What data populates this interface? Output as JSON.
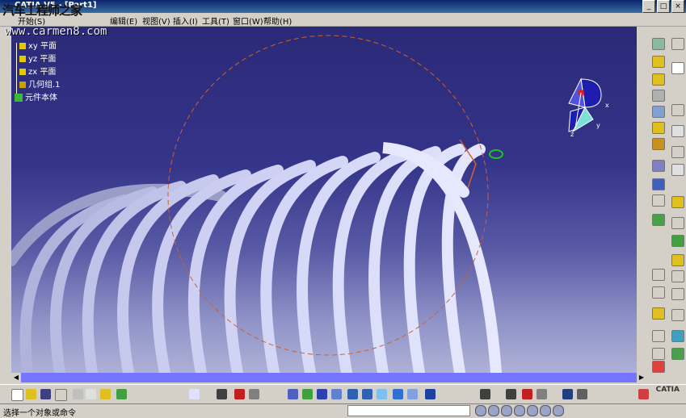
{
  "window": {
    "title": "CATIA V5 - [Part1]"
  },
  "watermark": {
    "line1": "汽车工程师之家",
    "line2": "www.carmen8.com"
  },
  "menu": [
    {
      "label": "开始(S)"
    },
    {
      "label": "编辑(E)"
    },
    {
      "label": "视图(V)"
    },
    {
      "label": "插入(I)"
    },
    {
      "label": "工具(T)"
    },
    {
      "label": "窗口(W)"
    },
    {
      "label": "帮助(H)"
    }
  ],
  "tree": {
    "items": [
      {
        "label": "xy 平面"
      },
      {
        "label": "yz 平面"
      },
      {
        "label": "zx 平面"
      },
      {
        "label": "几何组.1"
      },
      {
        "label": "元件本体"
      }
    ]
  },
  "compass": {
    "x": "x",
    "y": "y",
    "z": "z"
  },
  "status": {
    "message": "选择一个对象或命令",
    "command_value": ""
  },
  "colors": {
    "viewport_top": "#2b2a78",
    "viewport_bottom": "#aeb1d6",
    "spring": "#c8cbee",
    "circle": "#d2602a"
  },
  "logo": {
    "text": "CATIA"
  }
}
